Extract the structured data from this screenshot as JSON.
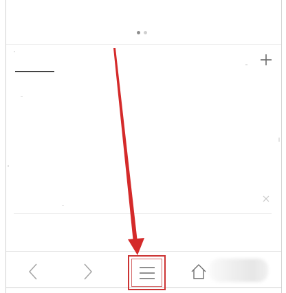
{
  "app": {
    "kind": "mobile-browser-new-tab"
  },
  "pager": {
    "page_count": 2,
    "current_page": 1
  },
  "toolbar": {
    "buttons": [
      "back",
      "forward",
      "menu",
      "home"
    ],
    "highlighted_button": "menu"
  },
  "icons": {
    "add": "plus-icon",
    "close": "close-x-icon",
    "back": "chevron-left-icon",
    "forward": "chevron-right-icon",
    "menu": "hamburger-menu-icon",
    "home": "home-icon"
  },
  "colors": {
    "annotation_red": "#d42a2a",
    "highlight_border": "#cc3333",
    "active_dot": "#8e8e8e",
    "inactive_dot": "#d0d0d0",
    "icon_gray": "#9a9a9a",
    "tab_underline": "#444444"
  }
}
